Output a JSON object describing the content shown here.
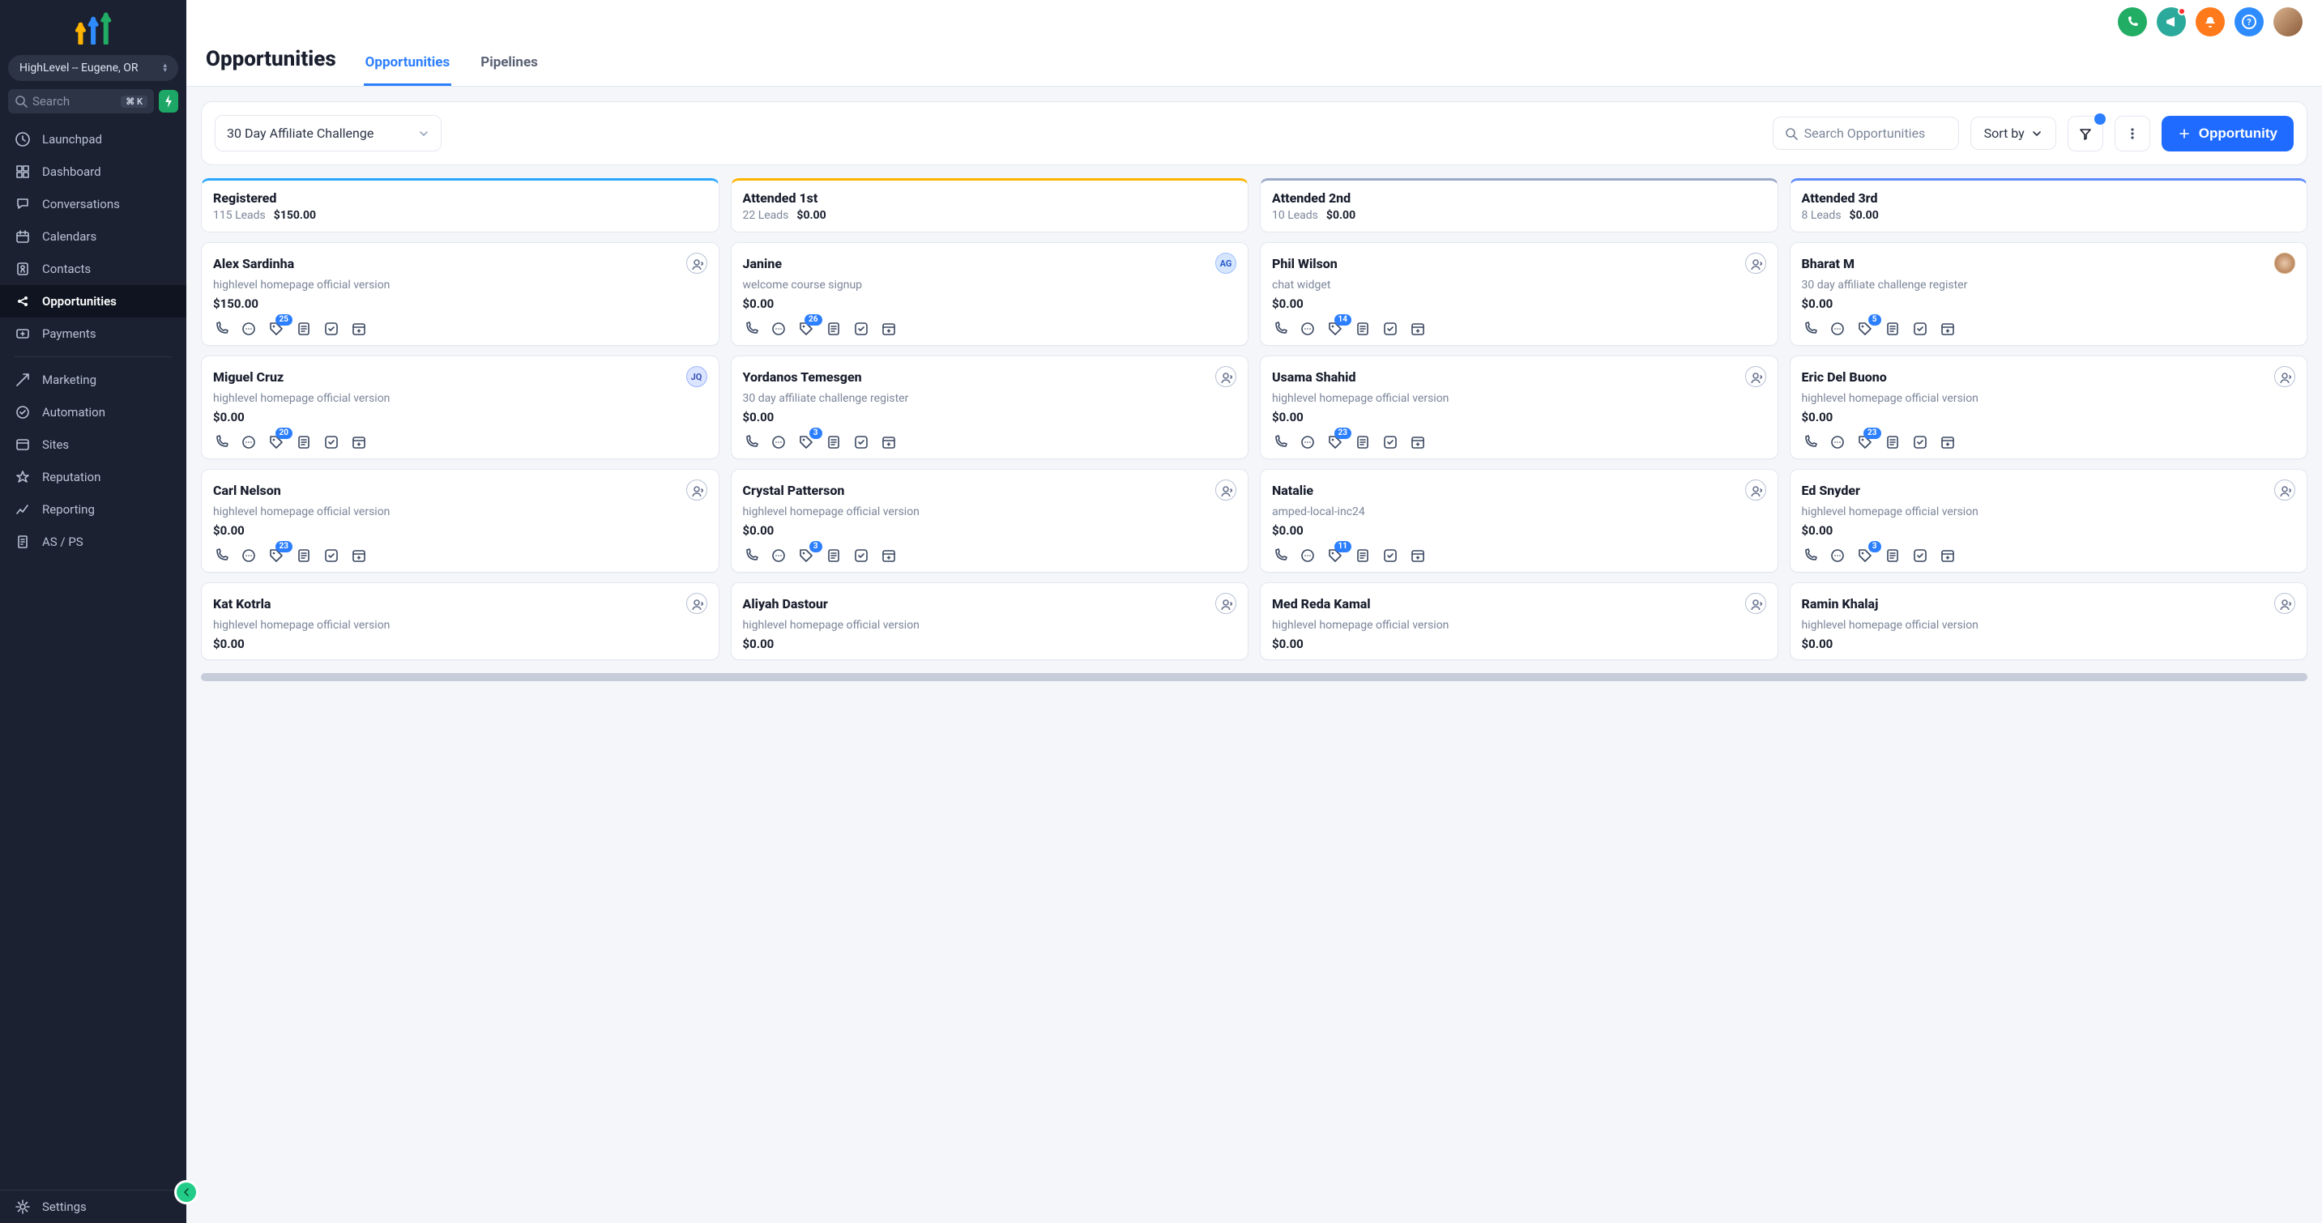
{
  "location_label": "HighLevel -- Eugene, OR",
  "search_placeholder": "Search",
  "search_kbd": "⌘ K",
  "sidebar": {
    "items": [
      {
        "label": "Launchpad",
        "icon": "launch"
      },
      {
        "label": "Dashboard",
        "icon": "dashboard"
      },
      {
        "label": "Conversations",
        "icon": "chat"
      },
      {
        "label": "Calendars",
        "icon": "calendar"
      },
      {
        "label": "Contacts",
        "icon": "contact"
      },
      {
        "label": "Opportunities",
        "icon": "opps",
        "active": true
      },
      {
        "label": "Payments",
        "icon": "payments"
      }
    ],
    "items2": [
      {
        "label": "Marketing",
        "icon": "send"
      },
      {
        "label": "Automation",
        "icon": "automation"
      },
      {
        "label": "Sites",
        "icon": "sites"
      },
      {
        "label": "Reputation",
        "icon": "star"
      },
      {
        "label": "Reporting",
        "icon": "chart"
      },
      {
        "label": "AS / PS",
        "icon": "doc"
      }
    ],
    "bottom": {
      "label": "Settings",
      "icon": "gear"
    }
  },
  "page": {
    "title": "Opportunities",
    "tabs": [
      "Opportunities",
      "Pipelines"
    ],
    "active_tab": 0
  },
  "toolbar": {
    "pipeline": "30 Day Affiliate Challenge",
    "search_placeholder": "Search Opportunities",
    "sort_label": "Sort by",
    "new_label": "Opportunity"
  },
  "columns": [
    {
      "title": "Registered",
      "leads": "115 Leads",
      "total": "$150.00",
      "color": "c0"
    },
    {
      "title": "Attended 1st",
      "leads": "22 Leads",
      "total": "$0.00",
      "color": "c1"
    },
    {
      "title": "Attended 2nd",
      "leads": "10 Leads",
      "total": "$0.00",
      "color": "c2"
    },
    {
      "title": "Attended 3rd",
      "leads": "8 Leads",
      "total": "$0.00",
      "color": "c3"
    }
  ],
  "cards": [
    [
      {
        "name": "Alex Sardinha",
        "src": "highlevel homepage official version",
        "amt": "$150.00",
        "badge": "25",
        "assign": "none"
      },
      {
        "name": "Miguel Cruz",
        "src": "highlevel homepage official version",
        "amt": "$0.00",
        "badge": "20",
        "assign": "jq",
        "initials": "JQ"
      },
      {
        "name": "Carl Nelson",
        "src": "highlevel homepage official version",
        "amt": "$0.00",
        "badge": "23",
        "assign": "none"
      },
      {
        "name": "Kat Kotrla",
        "src": "highlevel homepage official version",
        "amt": "$0.00",
        "badge": "",
        "assign": "none",
        "short": true
      }
    ],
    [
      {
        "name": "Janine",
        "src": "welcome course signup",
        "amt": "$0.00",
        "badge": "26",
        "assign": "ag",
        "initials": "AG"
      },
      {
        "name": "Yordanos Temesgen",
        "src": "30 day affiliate challenge register",
        "amt": "$0.00",
        "badge": "3",
        "assign": "none"
      },
      {
        "name": "Crystal Patterson",
        "src": "highlevel homepage official version",
        "amt": "$0.00",
        "badge": "3",
        "assign": "none"
      },
      {
        "name": "Aliyah Dastour",
        "src": "highlevel homepage official version",
        "amt": "$0.00",
        "badge": "",
        "assign": "none",
        "short": true
      }
    ],
    [
      {
        "name": "Phil Wilson",
        "src": "chat widget",
        "amt": "$0.00",
        "badge": "14",
        "assign": "none"
      },
      {
        "name": "Usama Shahid",
        "src": "highlevel homepage official version",
        "amt": "$0.00",
        "badge": "23",
        "assign": "none"
      },
      {
        "name": "Natalie",
        "src": "amped-local-inc24",
        "amt": "$0.00",
        "badge": "11",
        "assign": "none"
      },
      {
        "name": "Med Reda Kamal",
        "src": "highlevel homepage official version",
        "amt": "$0.00",
        "badge": "",
        "assign": "none",
        "short": true
      }
    ],
    [
      {
        "name": "Bharat M",
        "src": "30 day affiliate challenge register",
        "amt": "$0.00",
        "badge": "5",
        "assign": "img"
      },
      {
        "name": "Eric Del Buono",
        "src": "highlevel homepage official version",
        "amt": "$0.00",
        "badge": "23",
        "assign": "none"
      },
      {
        "name": "Ed Snyder",
        "src": "highlevel homepage official version",
        "amt": "$0.00",
        "badge": "3",
        "assign": "none"
      },
      {
        "name": "Ramin Khalaj",
        "src": "highlevel homepage official version",
        "amt": "$0.00",
        "badge": "",
        "assign": "none",
        "short": true
      }
    ]
  ]
}
